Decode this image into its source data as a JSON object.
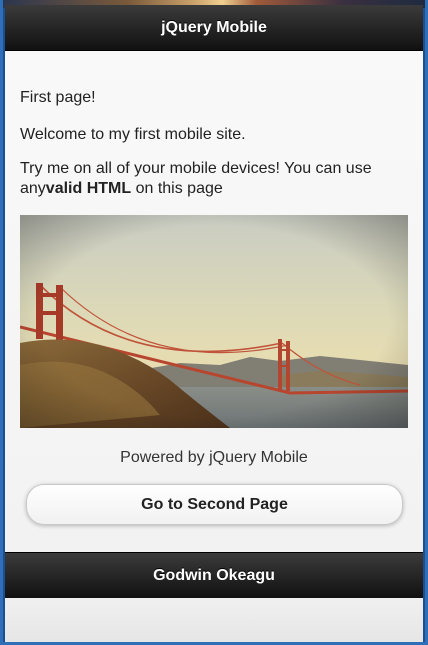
{
  "header": {
    "title": "jQuery Mobile"
  },
  "content": {
    "line1": "First page!",
    "line2": "Welcome to my first mobile site.",
    "line3_start": "Try me on all of your mobile devices! You can use any",
    "line3_bold": "valid HTML",
    "line3_end": " on this page",
    "image_subject": "golden-gate-bridge",
    "powered_by": "Powered by jQuery Mobile",
    "button_label": "Go to Second Page"
  },
  "footer": {
    "title": "Godwin Okeagu"
  },
  "colors": {
    "bar": "#1a1a1a",
    "content_bg": "#f6f6f6",
    "window_border": "#2f6fb8"
  }
}
